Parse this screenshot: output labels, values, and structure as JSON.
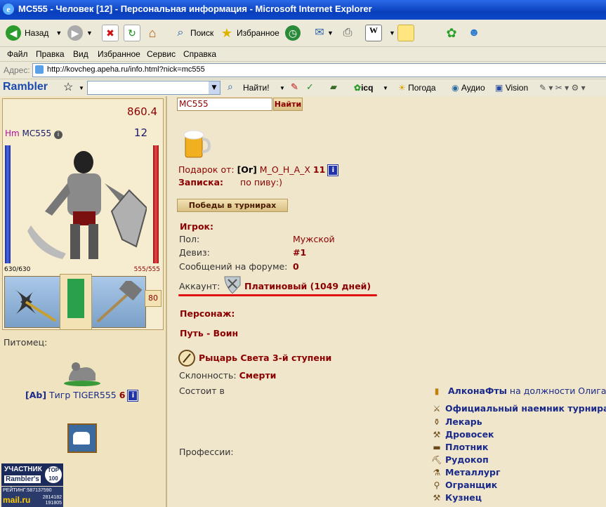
{
  "window": {
    "title": "MC555 - Человек [12] - Персональная информация - Microsoft Internet Explorer"
  },
  "toolbar": {
    "back_label": "Назад",
    "search_label": "Поиск",
    "favorites_label": "Избранное"
  },
  "menu": [
    "Файл",
    "Правка",
    "Вид",
    "Избранное",
    "Сервис",
    "Справка"
  ],
  "address": {
    "label": "Адрес:",
    "url": "http://kovcheg.apeha.ru/info.html?nick=mc555"
  },
  "rambler": {
    "logo": "Rambler",
    "find_label": "Найти!",
    "icq": "icq",
    "weather": "Погода",
    "audio": "Аудио",
    "vision": "Vision"
  },
  "character": {
    "race": "Hm",
    "nick": "MC555",
    "score": "860.4",
    "level": "12",
    "hp": "630/630",
    "mana": "555/555",
    "weapon_count": "80",
    "hp_fill": 1.0,
    "mana_fill": 1.0
  },
  "pet": {
    "label": "Питомец:",
    "clan": "[Ab]",
    "name": "Тигр TIGER555",
    "level": "6"
  },
  "counters": {
    "top_label": "УЧАСТНИК",
    "rambler": "Rambler's",
    "top100": "TOP 100",
    "rating": "РЕЙТИНГ:587137590",
    "mailru": "mail.ru",
    "n1": "2814182",
    "n2": "191805"
  },
  "search": {
    "value": "MC555",
    "button": "Найти"
  },
  "gift": {
    "from_label": "Подарок от:",
    "from_clan": "[Or]",
    "from_name": "М_О_Н_А_Х",
    "from_level": "11",
    "note_label": "Записка:",
    "note_text": "по пиву:)"
  },
  "tournament_button": "Победы в турнирах",
  "player": {
    "header": "Игрок:",
    "gender_label": "Пол:",
    "gender": "Мужской",
    "motto_label": "Девиз:",
    "motto": "#1",
    "forum_label": "Сообщений на форуме:",
    "forum": "0",
    "account_label": "Аккаунт:",
    "account": "Платиновый (1049 дней)"
  },
  "persona": {
    "header": "Персонаж:",
    "path": "Путь - Воин",
    "rank": "Рыцарь Света 3-й ступени",
    "alignment_label": "Склонность:",
    "alignment": "Смерти",
    "member_label": "Состоит в",
    "clan_name": "АлконаФты",
    "clan_post": "на должности Олигарх"
  },
  "professions": {
    "label": "Профессии:",
    "items": [
      "Официальный наемник турнира",
      "Лекарь",
      "Дровосек",
      "Плотник",
      "Рудокоп",
      "Металлург",
      "Огранщик",
      "Кузнец"
    ]
  },
  "colors": {
    "accent": "#8b0000",
    "link": "#1a2a8a",
    "underline": "#e01010"
  }
}
